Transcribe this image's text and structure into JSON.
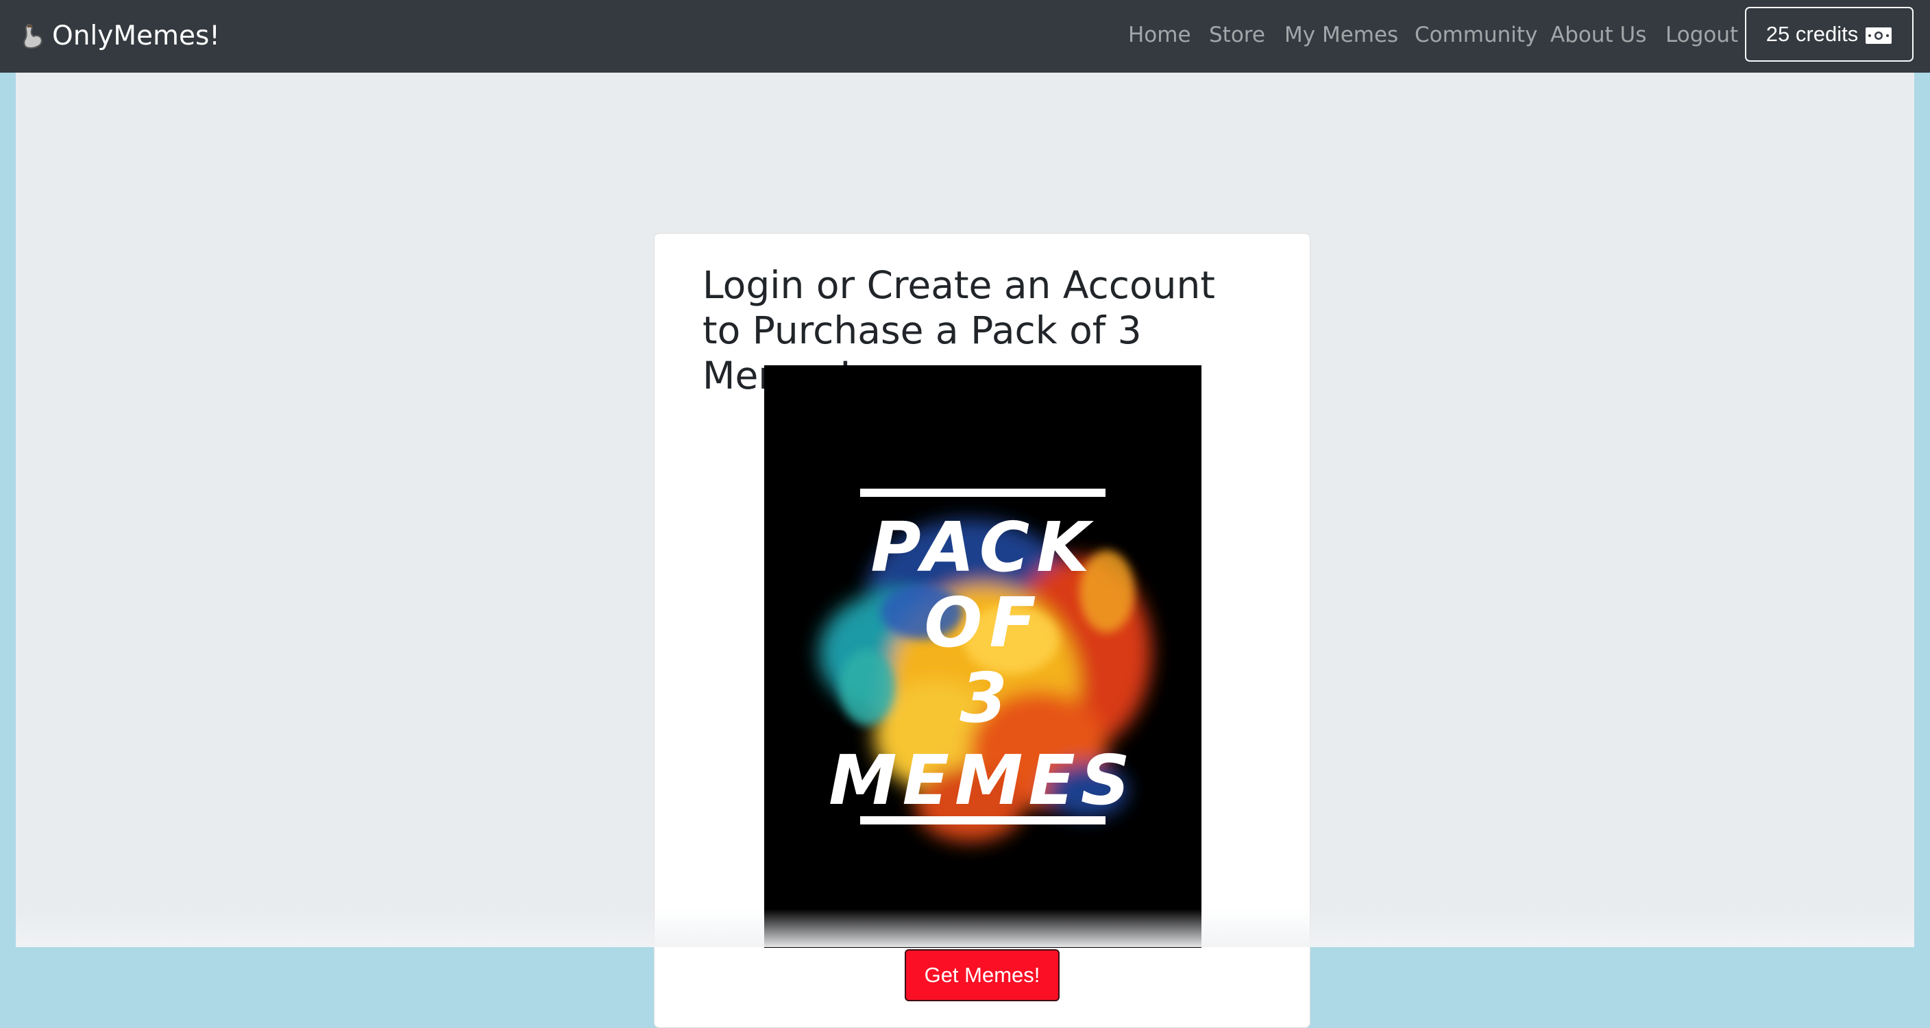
{
  "navbar": {
    "brand": "OnlyMemes!",
    "brand_icon": "flexed-arm-icon",
    "links": [
      {
        "label": "Home"
      },
      {
        "label": "Store"
      },
      {
        "label": "My Memes"
      },
      {
        "label": "Community"
      },
      {
        "label": "About Us"
      },
      {
        "label": "Logout"
      }
    ],
    "credits": {
      "label": "25 credits",
      "icon": "cash-icon"
    }
  },
  "card": {
    "title": "Login or Create an Account to Purchase a Pack of 3 Memes!",
    "poster": {
      "line1": "PACK",
      "line2": "OF",
      "line3": "3",
      "line4": "MEMES"
    },
    "button": "Get Memes!"
  },
  "colors": {
    "navbar_bg": "#343a40",
    "page_bg": "#add8e6",
    "content_bg": "#e9ecef",
    "button_red": "#fa0f25"
  }
}
